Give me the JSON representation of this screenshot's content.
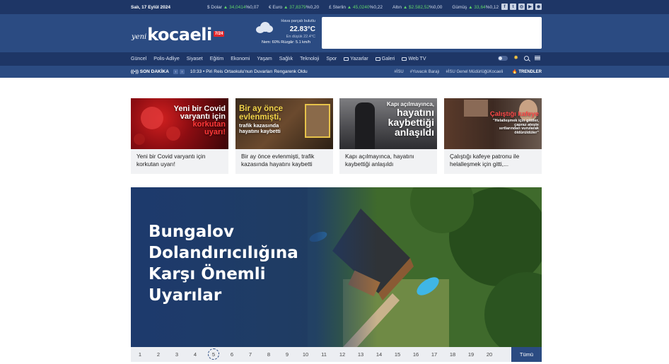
{
  "topbar": {
    "date": "Salı, 17 Eylül 2024",
    "tickers": [
      {
        "name": "$ Dolar",
        "value": "▲ 34,0414",
        "pct": "%0,07"
      },
      {
        "name": "€ Euro",
        "value": "▲ 37,8379",
        "pct": "%0,20"
      },
      {
        "name": "£ Sterlin",
        "value": "▲ 45,0240",
        "pct": "%0,22"
      },
      {
        "name": "Altın",
        "value": "▲ $2.582,52",
        "pct": "%0,00"
      },
      {
        "name": "Gümüş",
        "value": "▲ 33,64",
        "pct": "%0,12"
      }
    ],
    "socials": [
      "facebook-icon",
      "twitter-icon",
      "instagram-icon",
      "youtube-icon",
      "rss-icon"
    ]
  },
  "header": {
    "logo_small": "yeni",
    "logo_main": "kocaeli",
    "logo_badge": "7/24",
    "weather": {
      "desc": "Hava parçalı bulutlu",
      "temp": "22.83°C",
      "low": "En düşük 22.4°C",
      "humidity": "Nem: 60% Rüzgâr: 5.1 km/h"
    }
  },
  "nav": {
    "items": [
      "Güncel",
      "Polis-Adliye",
      "Siyaset",
      "Eğitim",
      "Ekonomi",
      "Yaşam",
      "Sağlık",
      "Teknoloji",
      "Spor",
      "Yazarlar",
      "Galeri",
      "Web TV"
    ]
  },
  "breaking": {
    "label": "SON DAKİKA",
    "news": "10:33 • Piri Reis Ortaokulu'nun Duvarları Rengarenk Oldu",
    "tags": [
      "#İSU",
      "#Yuvacık Barajı",
      "#İSU Genel MüdürlüğüKocaeli"
    ],
    "trends": "TRENDLER"
  },
  "cards": [
    {
      "overlay": [
        "Yeni bir Covid",
        "varyantı için",
        "korkutan",
        "uyarı!"
      ],
      "caption": "Yeni bir Covid varyantı için korkutan uyarı!"
    },
    {
      "overlay": [
        "Bir ay önce",
        "evlenmişti,",
        "trafik kazasında",
        "hayatını kaybetti"
      ],
      "caption": "Bir ay önce evlenmişti, trafik kazasında hayatını kaybetti"
    },
    {
      "overlay": [
        "Kapı açılmayınca,",
        "hayatını",
        "kaybettiği",
        "anlaşıldı"
      ],
      "caption": "Kapı açılmayınca, hayatını kaybettiği anlaşıldı"
    },
    {
      "overlay": [
        "Çalıştığı kafeye",
        "\"Helalleşmek için gittiler,",
        "çapraz ateşte",
        "sırtlarından vurularak",
        "öldürüldüler\""
      ],
      "caption": "Çalıştığı kafeye patronu ile helalleşmek için gitti,..."
    }
  ],
  "hero": {
    "title": "Bungalov Dolandırıcılığına Karşı Önemli Uyarılar"
  },
  "pager": {
    "pages": [
      "1",
      "2",
      "3",
      "4",
      "5",
      "6",
      "7",
      "8",
      "9",
      "10",
      "11",
      "12",
      "13",
      "14",
      "15",
      "16",
      "17",
      "18",
      "19",
      "20"
    ],
    "active": "5",
    "all_label": "Tümü"
  }
}
